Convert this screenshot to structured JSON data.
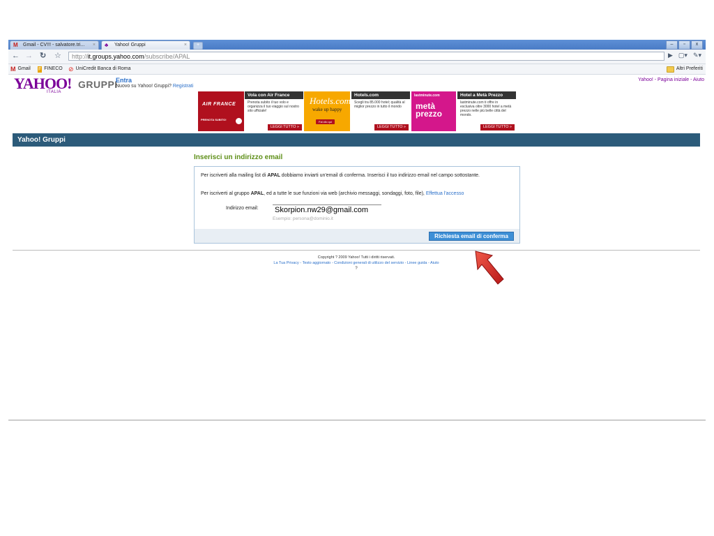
{
  "browser": {
    "tabs": [
      {
        "label": "Gmail - CV!!! - salvatore.tri...",
        "icon": "gmail-icon"
      },
      {
        "label": "Yahoo! Gruppi",
        "icon": "yahoo-icon"
      }
    ],
    "url_scheme": "http://",
    "url_host": "it.groups.yahoo.com",
    "url_path": "/subscribe/APAL",
    "bookmarks": [
      "Gmail",
      "FINECO",
      "UniCredit Banca di Roma"
    ],
    "other_bookmarks": "Altri Preferiti"
  },
  "header": {
    "logo": "YAHOO!",
    "logo_country": "ITALIA",
    "product": "GRUPPI",
    "signin": "Entra",
    "new_user": "Nuovo su Yahoo! Gruppi?",
    "register": "Registrati",
    "top_links": "Yahoo! - Pagina iniziale - Aiuto"
  },
  "ads": {
    "airfrance_brand": "AIR FRANCE",
    "airfrance_cta": "PRENOTA SUBITO!",
    "airfrance_title": "Vola con Air France",
    "airfrance_body": "Prenota subito il tuo volo e organizza il tuo viaggio sul nostro sito ufficiale!",
    "hotels_logo": "Hotels.com",
    "hotels_tagline": "wake up happy",
    "hotels_cta": "Fai clic qui",
    "hotels_title": "Hotels.com",
    "hotels_body": "Scegli tra 85.000 hotel; qualità al miglior prezzo in tutto il mondo",
    "lm_logo": "lastminute.com",
    "lm_big": "metà prezzo",
    "lm_title": "Hotel a Metà Prezzo",
    "lm_body": "lastminute.com ti offre in esclusiva oltre 3000 hotel a metà prezzo nelle più belle città del mondo.",
    "more": "LEGGI TUTTO »"
  },
  "bar_title": "Yahoo! Gruppi",
  "form": {
    "title": "Inserisci un indirizzo email",
    "p1_a": "Per iscriverti alla mailing list di ",
    "p1_group": "APAL",
    "p1_b": " dobbiamo inviarti un'email di conferma. Inserisci il tuo indirizzo email nel campo sottostante.",
    "p2_a": "Per iscriverti al gruppo ",
    "p2_group": "APAL",
    "p2_b": ", ed a tutte le sue funzioni via web (archivio messaggi, sondaggi, foto, file), ",
    "p2_link": "Effettua l'accesso",
    "email_label": "Indirizzo email:",
    "email_value": "Skorpion.nw29@gmail.com",
    "email_hint": "Esempio: persona@dominio.it",
    "submit": "Richiesta email di conferma"
  },
  "footer": {
    "copyright": "Copyright ? 2009 Yahoo! Tutti i diritti riservati.",
    "links": [
      "La Tua Privacy",
      "Testo aggiornato",
      "Condizioni generali di utilizzo del servizio",
      "Linee guida",
      "Aiuto"
    ],
    "qmark": "?"
  },
  "colors": {
    "yahoo_purple": "#7b0099",
    "bar_blue": "#2c5b7a",
    "title_green": "#5e8f18",
    "arrow_red": "#d42a2a"
  }
}
